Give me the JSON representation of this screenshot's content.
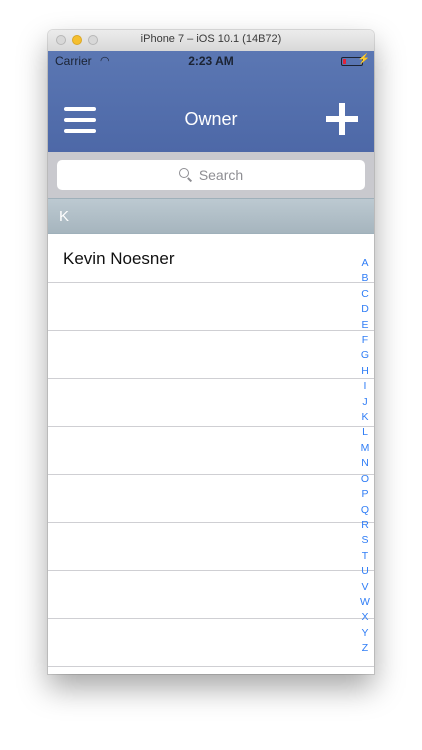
{
  "window": {
    "title": "iPhone 7 – iOS 10.1 (14B72)"
  },
  "status_bar": {
    "carrier": "Carrier",
    "time": "2:23 AM",
    "battery_color": "#e0233b"
  },
  "nav": {
    "title": "Owner",
    "menu_icon": "hamburger-menu-icon",
    "add_icon": "plus-icon",
    "color": "#5670ad"
  },
  "search": {
    "placeholder": "Search"
  },
  "section": {
    "letter": "K"
  },
  "rows": [
    "Kevin Noesner",
    "",
    "",
    "",
    "",
    "",
    "",
    "",
    "",
    ""
  ],
  "index_letters": [
    "A",
    "B",
    "C",
    "D",
    "E",
    "F",
    "G",
    "H",
    "I",
    "J",
    "K",
    "L",
    "M",
    "N",
    "O",
    "P",
    "Q",
    "R",
    "S",
    "T",
    "U",
    "V",
    "W",
    "X",
    "Y",
    "Z"
  ]
}
